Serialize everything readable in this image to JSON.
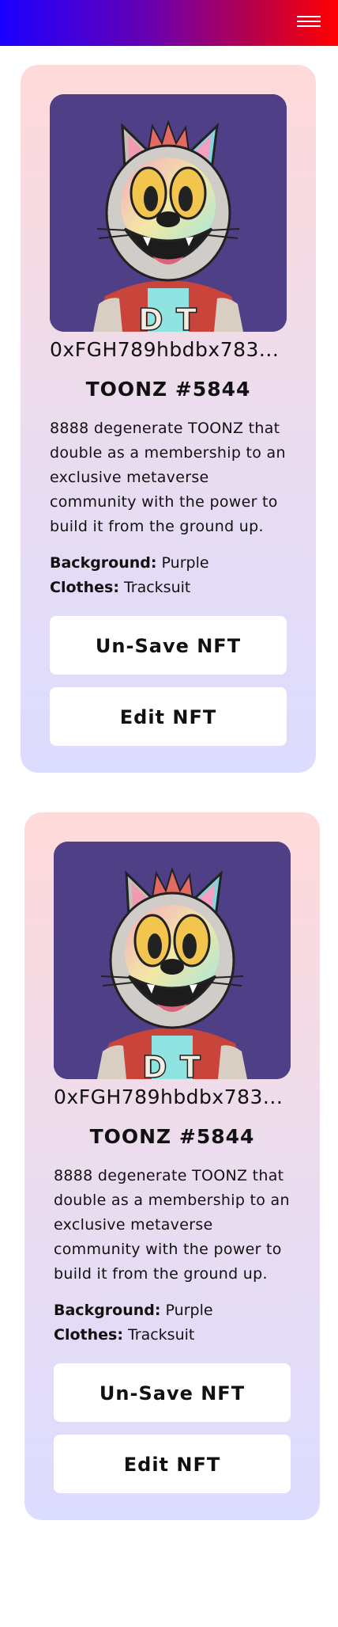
{
  "header": {
    "menu_icon": "hamburger-menu-icon",
    "gradient_colors": [
      "#1a00ff",
      "#ff0000"
    ]
  },
  "cards": [
    {
      "image_icon": "cartoon-cat-nft-image",
      "token_id": "0xFGH789hbdbx783...",
      "title": "TOONZ #5844",
      "description": "8888 degenerate TOONZ that double as a membership to an exclusive metaverse community with the power to build it from the ground up.",
      "attributes": [
        {
          "key": "Background:",
          "value": "Purple"
        },
        {
          "key": "Clothes:",
          "value": "Tracksuit"
        }
      ],
      "unsave_label": "Un-Save NFT",
      "edit_label": "Edit NFT"
    },
    {
      "image_icon": "cartoon-cat-nft-image",
      "token_id": "0xFGH789hbdbx783...",
      "title": "TOONZ #5844",
      "description": "8888 degenerate TOONZ that double as a membership to an exclusive metaverse community with the power to build it from the ground up.",
      "attributes": [
        {
          "key": "Background:",
          "value": "Purple"
        },
        {
          "key": "Clothes:",
          "value": "Tracksuit"
        }
      ],
      "unsave_label": "Un-Save NFT",
      "edit_label": "Edit NFT"
    }
  ],
  "colors": {
    "card_top": "#ffdada",
    "card_bottom": "#dcdcff",
    "image_bg": "#4f3f86"
  }
}
